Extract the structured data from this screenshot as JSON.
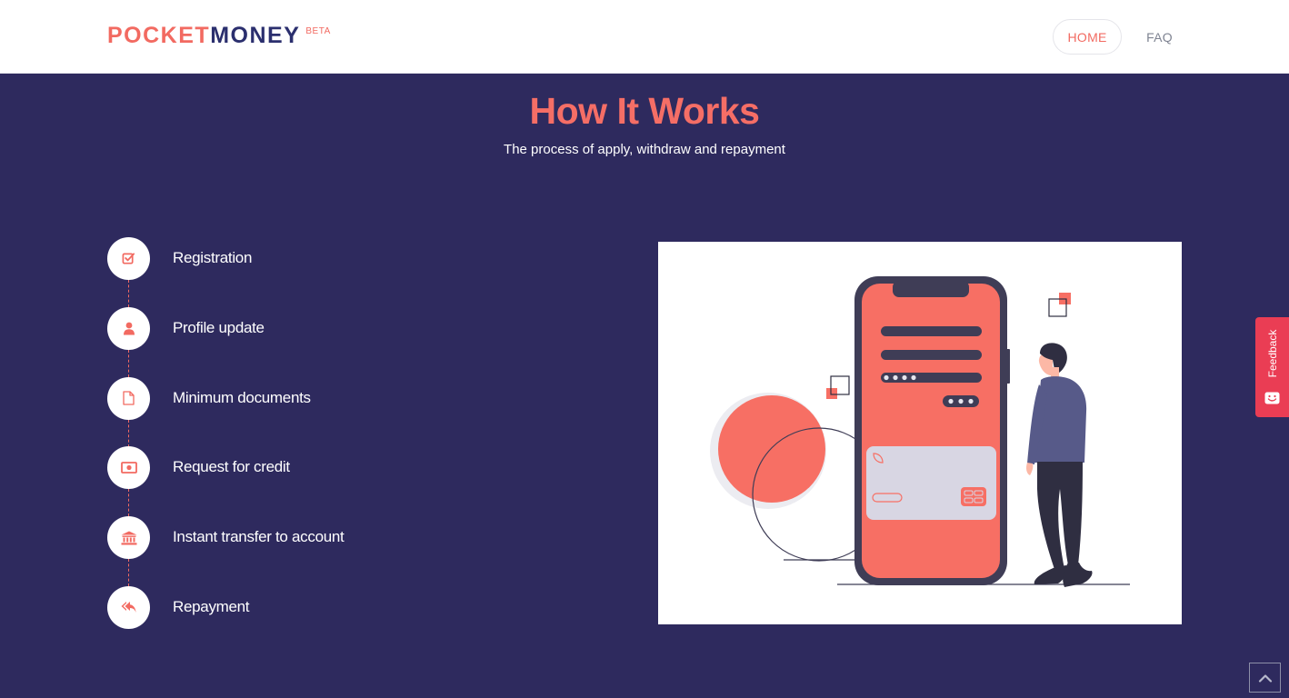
{
  "header": {
    "logo": {
      "part1": "POCKET",
      "part2": "MONEY",
      "badge": "BETA"
    },
    "nav": {
      "home": "HOME",
      "faq": "FAQ"
    }
  },
  "hero": {
    "title": "How It Works",
    "subtitle": "The process of apply, withdraw and repayment"
  },
  "steps": [
    {
      "label": "Registration",
      "icon": "checkbox-icon"
    },
    {
      "label": "Profile update",
      "icon": "user-icon"
    },
    {
      "label": "Minimum documents",
      "icon": "document-icon"
    },
    {
      "label": "Request for credit",
      "icon": "money-icon"
    },
    {
      "label": "Instant transfer to account",
      "icon": "bank-icon"
    },
    {
      "label": "Repayment",
      "icon": "reply-icon"
    }
  ],
  "feedback": {
    "label": "Feedback"
  },
  "colors": {
    "accent": "#f26a61",
    "navy": "#2e2a5e",
    "feedback": "#ea3d54"
  }
}
